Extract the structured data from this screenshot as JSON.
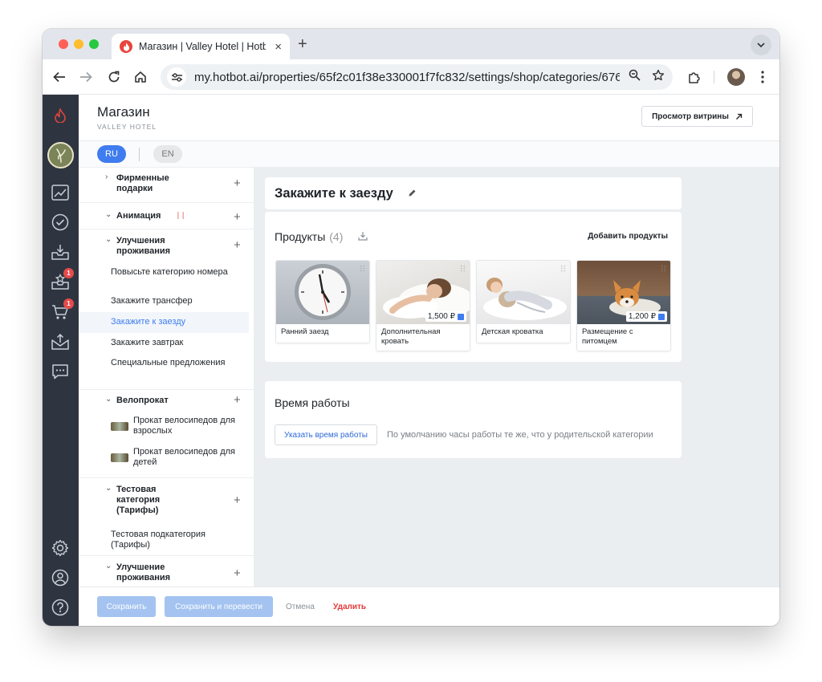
{
  "browser": {
    "tab_title": "Магазин | Valley Hotel | Hotbot",
    "url": "my.hotbot.ai/properties/65f2c01f38e330001f7fc832/settings/shop/categories/676..."
  },
  "header": {
    "title": "Магазин",
    "subtitle": "VALLEY HOTEL",
    "preview_button": "Просмотр витрины"
  },
  "languages": {
    "ru": "RU",
    "en": "EN",
    "active": "RU"
  },
  "rail": {
    "badges": {
      "orders": "1",
      "cart": "1"
    }
  },
  "tree": {
    "cat_gifts": "Фирменные подарки",
    "cat_animation": "Анимация",
    "cat_upgrades": "Улучшения проживания",
    "sub_upgrade_room": "Повысьте категорию номера",
    "sub_transfer": "Закажите трансфер",
    "sub_checkin": "Закажите к заезду",
    "sub_breakfast": "Закажите завтрак",
    "sub_special": "Специальные предложения",
    "cat_bikes": "Велопрокат",
    "sub_bikes_adult": "Прокат велосипедов для взрослых",
    "sub_bikes_kids": "Прокат велосипедов для детей",
    "cat_test": "Тестовая категория (Тарифы)",
    "sub_test": "Тестовая подкатегория (Тарифы)",
    "cat_upgrade2": "Улучшение проживания"
  },
  "category": {
    "title": "Закажите к заезду"
  },
  "products": {
    "heading": "Продукты",
    "count": "(4)",
    "add_button": "Добавить продукты",
    "items": [
      {
        "name": "Ранний заезд",
        "price": ""
      },
      {
        "name": "Дополнительная кровать",
        "price": "1,500 ₽"
      },
      {
        "name": "Детская кроватка",
        "price": ""
      },
      {
        "name": "Размещение с питомцем",
        "price": "1,200 ₽"
      }
    ]
  },
  "working_hours": {
    "title": "Время работы",
    "button": "Указать время работы",
    "note": "По умолчанию часы работы те же, что у родительской категории"
  },
  "footer": {
    "save": "Сохранить",
    "save_translate": "Сохранить и перевести",
    "cancel": "Отмена",
    "delete": "Удалить"
  },
  "colors": {
    "accent": "#3f7cf0",
    "rail": "#2f3540",
    "danger": "#e53935",
    "badge": "#e84a4a"
  }
}
